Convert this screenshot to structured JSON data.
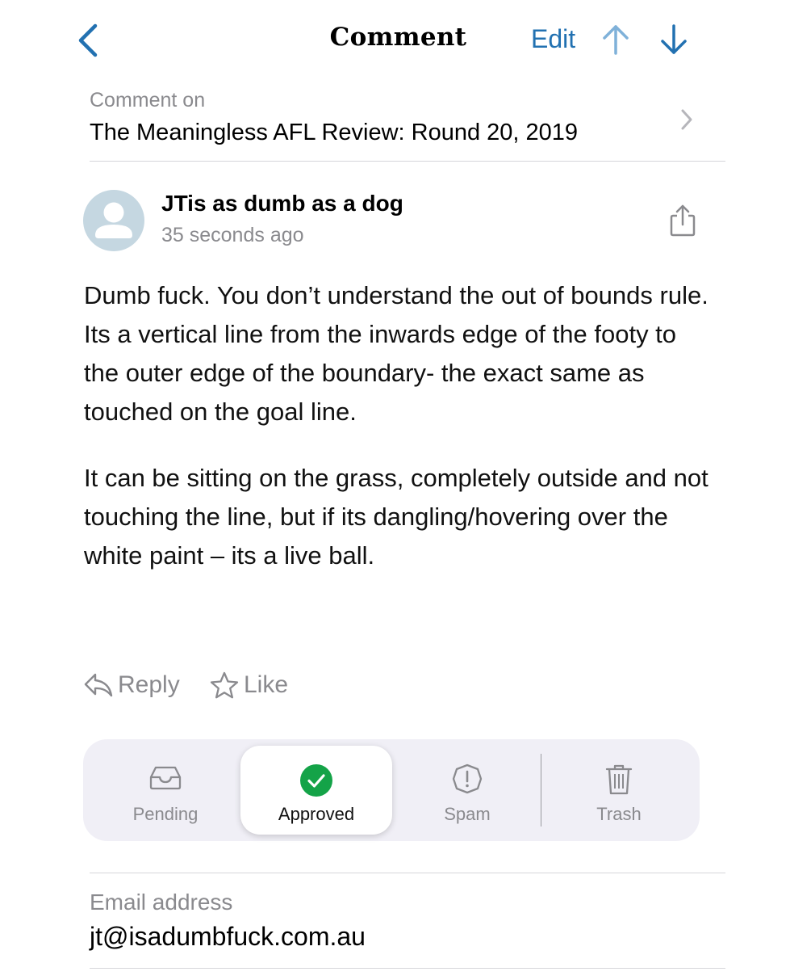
{
  "nav": {
    "title": "Comment",
    "edit_label": "Edit",
    "accent_color": "#2271b1"
  },
  "post": {
    "caption": "Comment on",
    "title": "The Meaningless AFL Review: Round 20, 2019"
  },
  "author": {
    "name": "JTis as dumb as a dog",
    "time_ago": "35 seconds ago",
    "avatar_icon": "person-icon"
  },
  "comment": {
    "paragraphs": [
      "Dumb fuck. You don’t understand the out of bounds rule. Its a vertical line from the inwards edge of the footy to the outer edge of the boundary- the exact same as touched on the goal line.",
      "It can be sitting on the grass, completely outside and not touching the line, but if its dangling/hovering over the white paint – its a live ball."
    ]
  },
  "actions": {
    "reply_label": "Reply",
    "like_label": "Like"
  },
  "status": {
    "selected": "Approved",
    "options": [
      {
        "label": "Pending",
        "icon": "inbox-icon"
      },
      {
        "label": "Approved",
        "icon": "checkmark-circle-icon",
        "color": "#14a348"
      },
      {
        "label": "Spam",
        "icon": "exclamation-circle-icon"
      },
      {
        "label": "Trash",
        "icon": "trash-icon"
      }
    ]
  },
  "email": {
    "label": "Email address",
    "value": "jt@isadumbfuck.com.au"
  }
}
